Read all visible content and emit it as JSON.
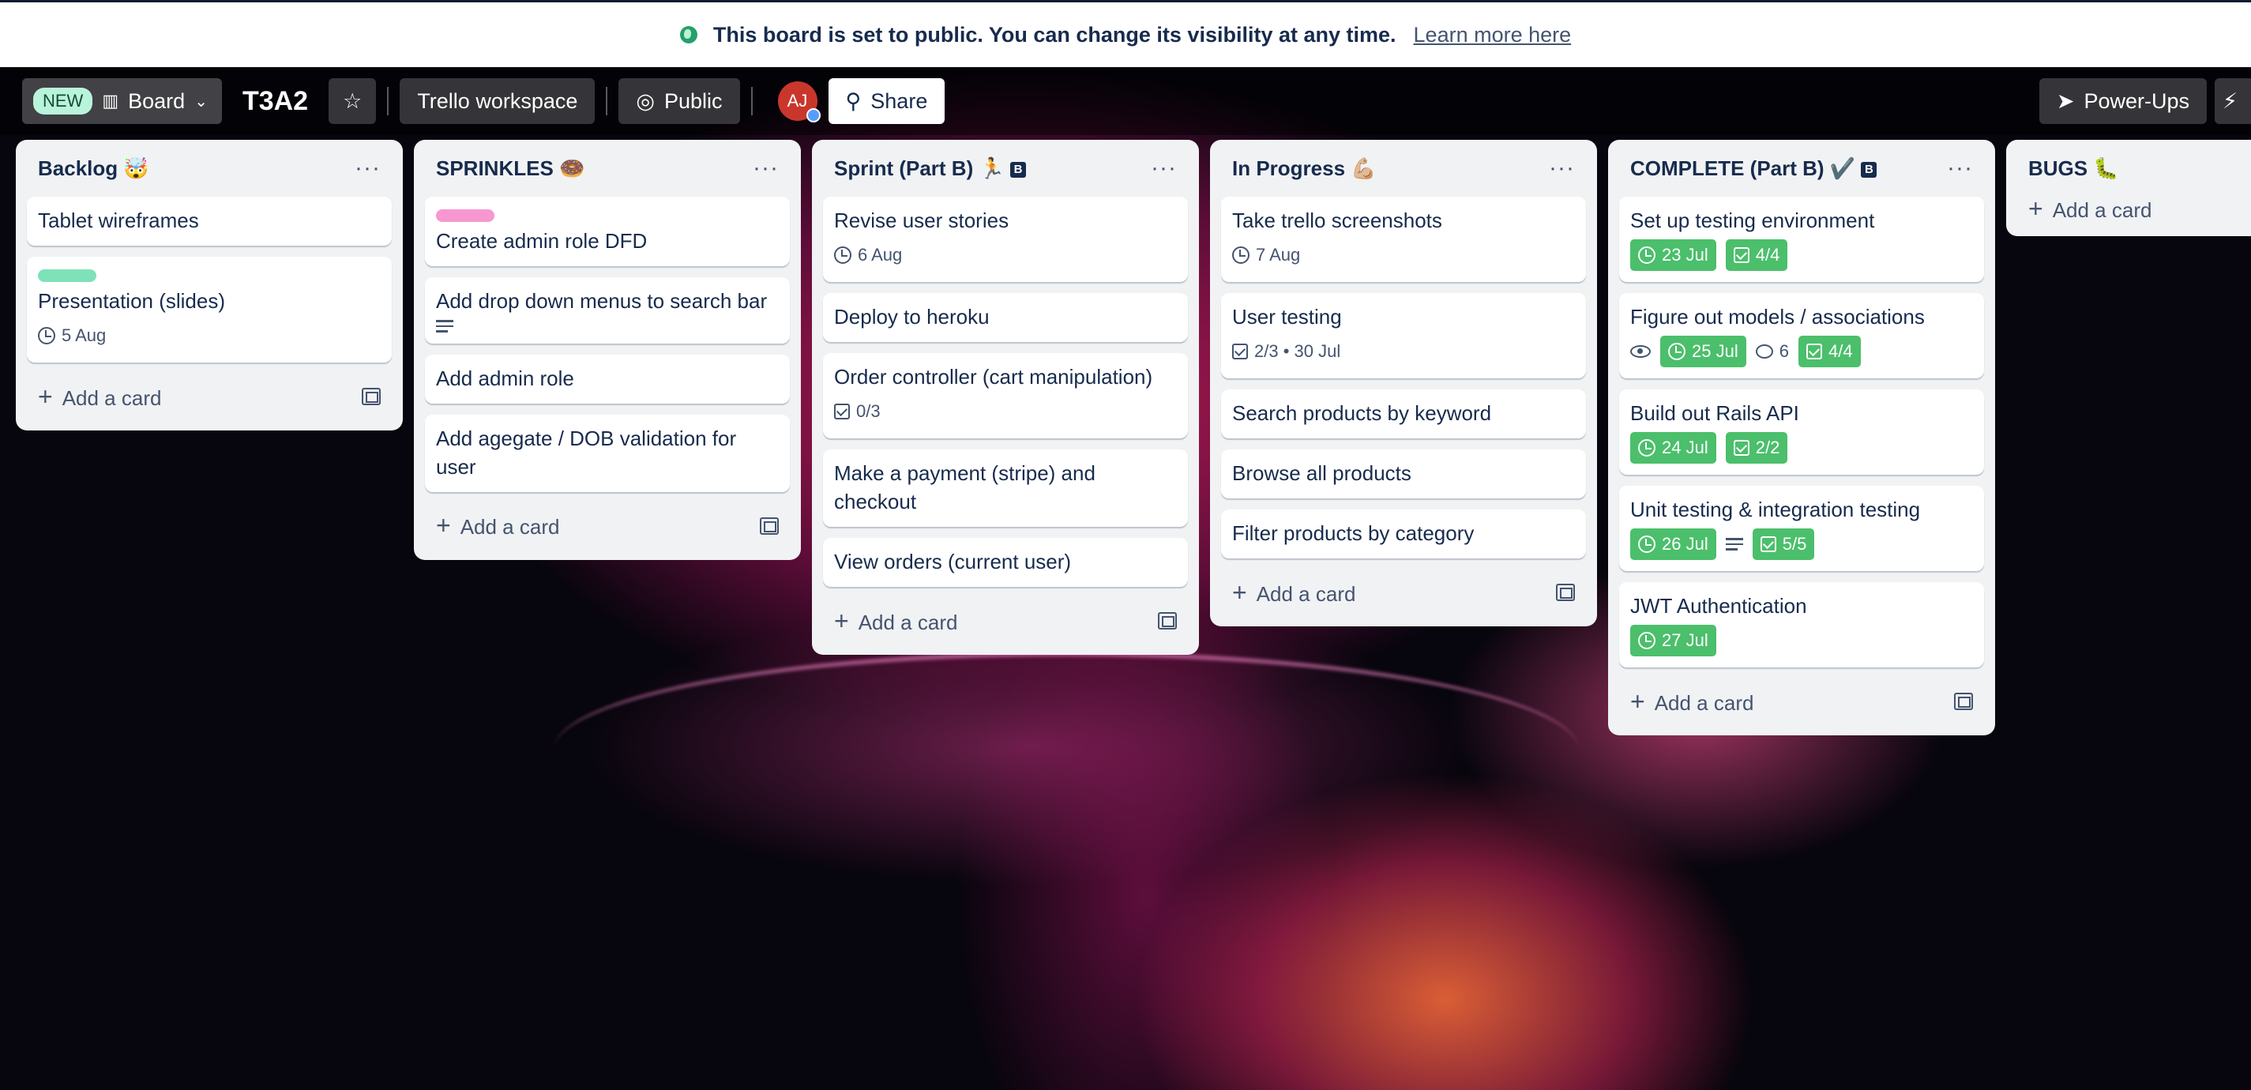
{
  "banner": {
    "message": "This board is set to public. You can change its visibility at any time.",
    "link": "Learn more here"
  },
  "header": {
    "new_badge": "NEW",
    "view": "Board",
    "board_title": "T3A2",
    "workspace": "Trello workspace",
    "visibility": "Public",
    "avatar_initials": "AJ",
    "share": "Share",
    "powerups": "Power-Ups"
  },
  "colors": {
    "due_complete": "#4bbf6b",
    "label_green": "#7ee2b8",
    "label_pink": "#f797d2",
    "avatar": "#c9372c"
  },
  "lists": [
    {
      "title": "Backlog 🤯",
      "cards": [
        {
          "title": "Tablet wireframes"
        },
        {
          "title": "Presentation (slides)",
          "due": "5 Aug"
        }
      ]
    },
    {
      "title": "SPRINKLES 🍩",
      "cards": [
        {
          "title": "Create admin role DFD"
        },
        {
          "title": "Add drop down menus to search bar"
        },
        {
          "title": "Add admin role"
        },
        {
          "title": "Add agegate / DOB validation for user"
        }
      ]
    },
    {
      "title": "Sprint (Part B) 🏃",
      "title_badge": "B",
      "cards": [
        {
          "title": "Revise user stories",
          "due": "6 Aug"
        },
        {
          "title": "Deploy to heroku"
        },
        {
          "title": "Order controller (cart manipulation)",
          "checklist": "0/3"
        },
        {
          "title": "Make a payment (stripe) and checkout"
        },
        {
          "title": "View orders (current user)"
        }
      ]
    },
    {
      "title": "In Progress 💪🏼",
      "cards": [
        {
          "title": "Take trello screenshots",
          "due": "7 Aug"
        },
        {
          "title": "User testing",
          "checklist": "2/3 • 30 Jul"
        },
        {
          "title": "Search products by keyword"
        },
        {
          "title": "Browse all products"
        },
        {
          "title": "Filter products by category"
        }
      ]
    },
    {
      "title": "COMPLETE (Part B) ✔️",
      "title_badge": "B",
      "cards": [
        {
          "title": "Set up testing environment",
          "due": "23 Jul",
          "checklist": "4/4"
        },
        {
          "title": "Figure out models / associations",
          "due": "25 Jul",
          "comments": "6",
          "checklist": "4/4"
        },
        {
          "title": "Build out Rails API",
          "due": "24 Jul",
          "checklist": "2/2"
        },
        {
          "title": "Unit testing & integration testing",
          "due": "26 Jul",
          "checklist": "5/5"
        },
        {
          "title": "JWT Authentication",
          "due": "27 Jul"
        }
      ]
    },
    {
      "title": "BUGS 🐛",
      "cards": []
    }
  ],
  "add_card_label": "Add a card"
}
